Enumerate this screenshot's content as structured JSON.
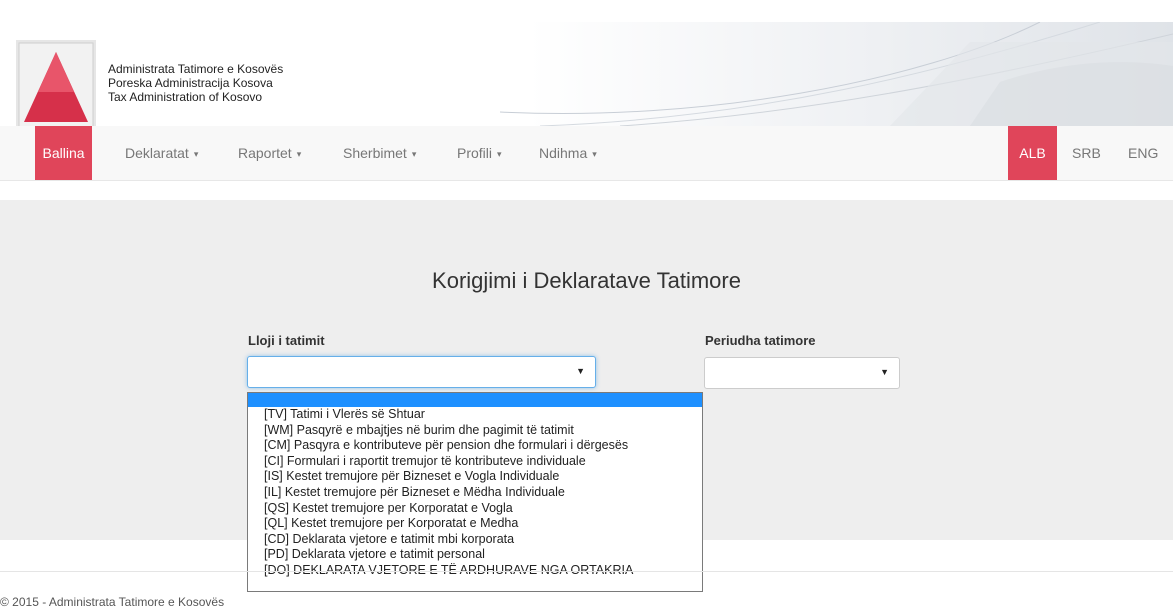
{
  "header": {
    "org_lines": [
      "Administrata Tatimore e Kosovës",
      "Poreska Administracija Kosova",
      "Tax Administration of Kosovo"
    ]
  },
  "nav": {
    "items": [
      {
        "label": "Ballina",
        "caret": "",
        "active": true
      },
      {
        "label": "Deklaratat",
        "caret": "▾"
      },
      {
        "label": "Raportet",
        "caret": "▾"
      },
      {
        "label": "Sherbimet",
        "caret": "▾"
      },
      {
        "label": "Profili",
        "caret": "▾"
      },
      {
        "label": "Ndihma",
        "caret": "▾"
      }
    ],
    "languages": [
      {
        "label": "ALB",
        "active": true
      },
      {
        "label": "SRB"
      },
      {
        "label": "ENG"
      }
    ]
  },
  "main": {
    "title": "Korigjimi i Deklaratave Tatimore",
    "tax_type_label": "Lloji i tatimit",
    "tax_period_label": "Periudha tatimore",
    "select_arrow": "▼"
  },
  "dropdown": {
    "options": [
      "[TV] Tatimi i Vlerës së Shtuar",
      "[WM] Pasqyrë e mbajtjes në burim dhe pagimit të tatimit",
      "[CM] Pasqyra e kontributeve për pension dhe formulari i dërgesës",
      "[CI] Formulari i raportit tremujor të kontributeve individuale",
      "[IS] Kestet tremujore për Bizneset e Vogla Individuale",
      "[IL] Kestet tremujore për Bizneset e Mëdha Individuale",
      "[QS] Kestet tremujore per Korporatat e Vogla",
      "[QL] Kestet tremujore per Korporatat e Medha",
      "[CD] Deklarata vjetore e tatimit mbi korporata",
      "[PD] Deklarata vjetore e tatimit personal",
      "[DO] DEKLARATA VJETORE E TË ARDHURAVE NGA ORTAKRIA"
    ]
  },
  "footer": {
    "text": "© 2015 - Administrata Tatimore e Kosovës"
  },
  "colors": {
    "accent": "#e0455a",
    "highlight": "#1e90ff",
    "jumbotron": "#eeeeee"
  }
}
